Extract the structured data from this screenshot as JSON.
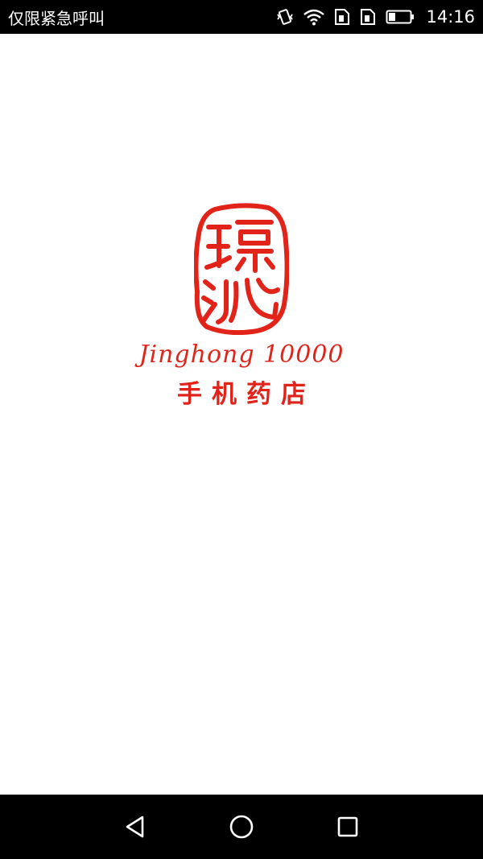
{
  "status_bar": {
    "carrier_text": "仅限紧急呼叫",
    "time": "14:16",
    "icons": [
      "vibrate-icon",
      "wifi-icon",
      "sim1-icon",
      "sim2-icon",
      "battery-icon"
    ]
  },
  "splash": {
    "seal_text": "璟泓",
    "brand_text": "Jinghong 10000",
    "store_text": "手机药店",
    "accent_color": "#e2231a"
  },
  "nav_bar": {
    "icons": [
      "back-icon",
      "home-icon",
      "recent-apps-icon"
    ]
  }
}
